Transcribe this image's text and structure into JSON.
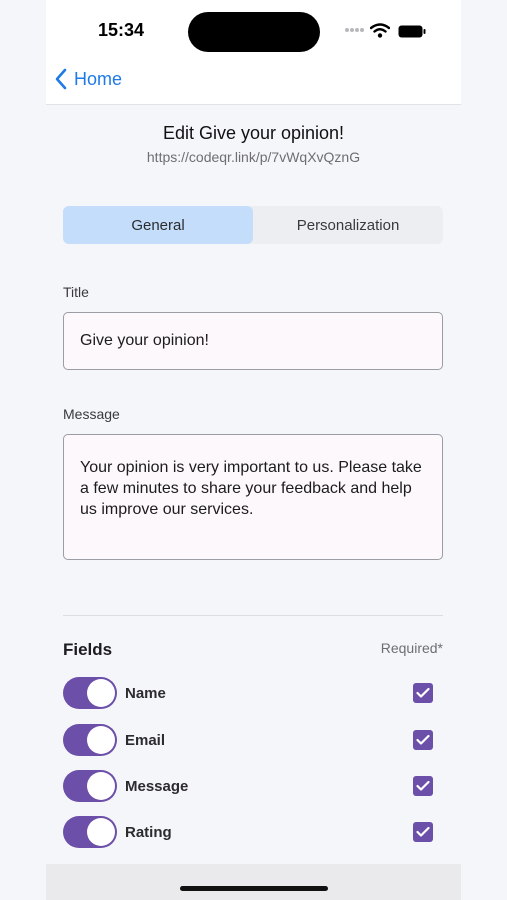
{
  "status": {
    "time": "15:34"
  },
  "nav": {
    "back_label": "Home"
  },
  "header": {
    "title": "Edit Give your opinion!",
    "url": "https://codeqr.link/p/7vWqXvQznG"
  },
  "tabs": [
    {
      "label": "General",
      "active": true
    },
    {
      "label": "Personalization",
      "active": false
    }
  ],
  "form": {
    "title_label": "Title",
    "title_value": "Give your opinion!",
    "message_label": "Message",
    "message_value": "Your opinion is very important to us. Please take a few minutes to share your feedback and help us improve our services."
  },
  "fields": {
    "heading": "Fields",
    "required_label": "Required*",
    "items": [
      {
        "label": "Name",
        "enabled": true,
        "required": true
      },
      {
        "label": "Email",
        "enabled": true,
        "required": true
      },
      {
        "label": "Message",
        "enabled": true,
        "required": true
      },
      {
        "label": "Rating",
        "enabled": true,
        "required": true
      }
    ]
  },
  "colors": {
    "accent": "#6c4fa8",
    "link": "#1f7ae6",
    "tab_active": "#c4ddfb"
  }
}
